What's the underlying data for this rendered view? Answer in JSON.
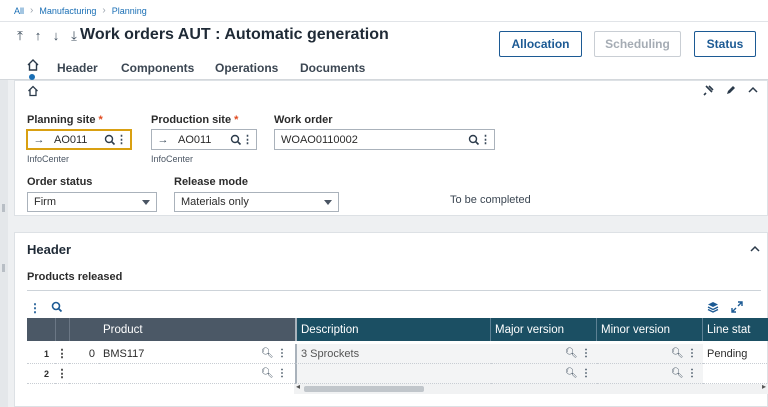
{
  "breadcrumb": {
    "items": [
      "All",
      "Manufacturing",
      "Planning"
    ]
  },
  "header": {
    "title": "Work orders AUT : Automatic generation",
    "buttons": {
      "allocation": "Allocation",
      "scheduling": "Scheduling",
      "status": "Status"
    }
  },
  "tabs": [
    "Header",
    "Components",
    "Operations",
    "Documents"
  ],
  "form": {
    "planning_site": {
      "label": "Planning site",
      "required_mark": "*",
      "value": "AO011",
      "sublabel": "InfoCenter"
    },
    "production_site": {
      "label": "Production site",
      "required_mark": "*",
      "value": "AO011",
      "sublabel": "InfoCenter"
    },
    "work_order": {
      "label": "Work order",
      "value": "WOAO0110002"
    },
    "order_status": {
      "label": "Order status",
      "value": "Firm"
    },
    "release_mode": {
      "label": "Release mode",
      "value": "Materials only"
    },
    "completion_note": "To be completed"
  },
  "section": {
    "title": "Header",
    "subtitle": "Products released",
    "columns": [
      "Product",
      "Description",
      "Major version",
      "Minor version",
      "Line stat"
    ],
    "rows": [
      {
        "num": "1",
        "idx": "0",
        "product": "BMS117",
        "description": "3 Sprockets",
        "major": "",
        "minor": "",
        "line_status": "Pending"
      },
      {
        "num": "2",
        "idx": "",
        "product": "",
        "description": "",
        "major": "",
        "minor": "",
        "line_status": ""
      }
    ]
  },
  "icons": [
    "home-icon",
    "search-icon",
    "more-icon",
    "pin-icon",
    "edit-icon",
    "chevron-up-icon",
    "layers-icon",
    "expand-icon",
    "arrow-right-icon"
  ],
  "colors": {
    "accent": "#1c5a94",
    "focus": "#d9a012",
    "required": "#e04a1f",
    "grid_header": "#1b4f63",
    "grid_frozen": "#4b5866"
  }
}
